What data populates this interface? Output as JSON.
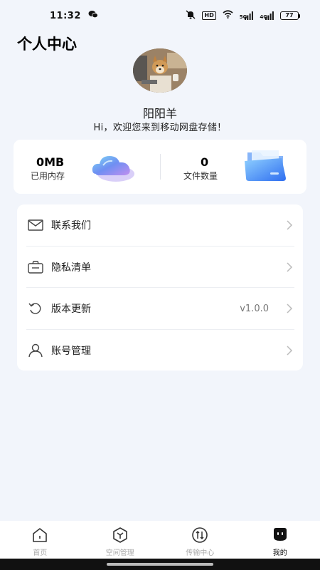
{
  "status_bar": {
    "time": "11:32",
    "hd_label": "HD",
    "signal_1_label": "5G",
    "signal_2_label": "4G",
    "battery": "77"
  },
  "header": {
    "title": "个人中心"
  },
  "profile": {
    "username": "阳阳羊",
    "welcome": "Hi，欢迎您来到移动网盘存储！"
  },
  "stats": {
    "used_storage_value": "0MB",
    "used_storage_label": "已用内存",
    "file_count_value": "0",
    "file_count_label": "文件数量"
  },
  "menu": {
    "items": [
      {
        "label": "联系我们",
        "value": "",
        "icon": "mail-icon"
      },
      {
        "label": "隐私清单",
        "value": "",
        "icon": "id-card-icon"
      },
      {
        "label": "版本更新",
        "value": "v1.0.0",
        "icon": "refresh-icon"
      },
      {
        "label": "账号管理",
        "value": "",
        "icon": "user-icon"
      }
    ]
  },
  "tab_bar": {
    "tabs": [
      {
        "label": "首页",
        "icon": "home-icon",
        "active": false
      },
      {
        "label": "空间管理",
        "icon": "storage-icon",
        "active": false
      },
      {
        "label": "传输中心",
        "icon": "transfer-icon",
        "active": false
      },
      {
        "label": "我的",
        "icon": "profile-icon",
        "active": true
      }
    ]
  },
  "colors": {
    "background": "#f2f5fb",
    "card": "#ffffff",
    "text_primary": "#111111",
    "text_inactive_tab": "#aaaaaa"
  }
}
